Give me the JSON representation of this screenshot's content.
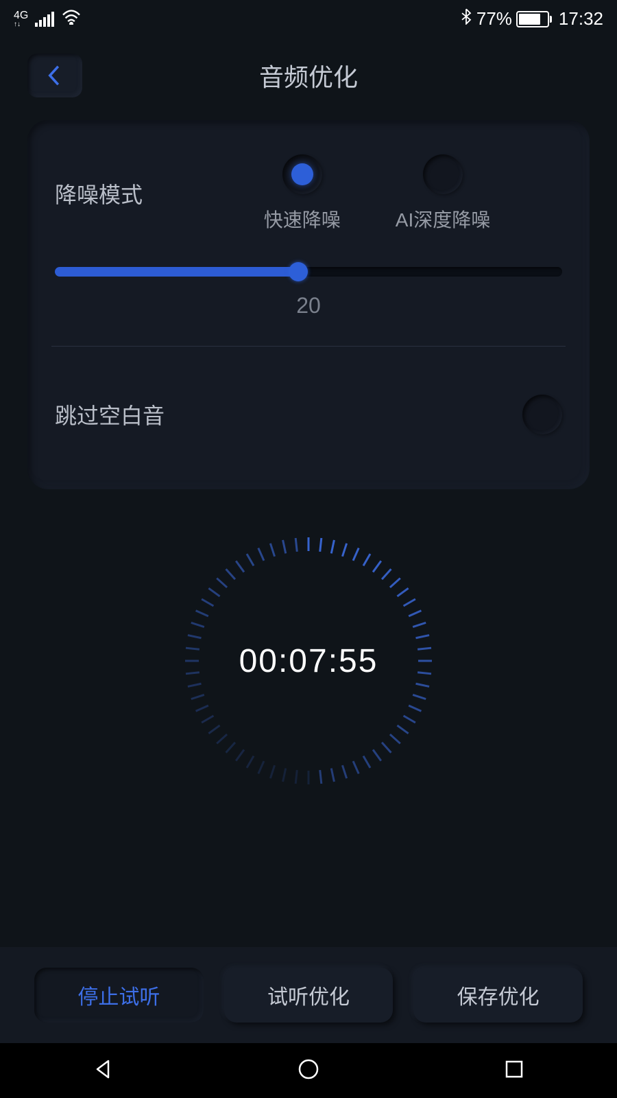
{
  "status": {
    "network": "4G",
    "bluetooth": true,
    "battery_percent": "77%",
    "time": "17:32"
  },
  "header": {
    "title": "音频优化"
  },
  "settings": {
    "noise_reduction": {
      "label": "降噪模式",
      "options": [
        {
          "label": "快速降噪",
          "selected": true
        },
        {
          "label": "AI深度降噪",
          "selected": false
        }
      ],
      "slider_value": "20"
    },
    "skip_silence": {
      "label": "跳过空白音",
      "enabled": false
    }
  },
  "timer": {
    "display": "00:07:55"
  },
  "buttons": {
    "stop": "停止试听",
    "preview": "试听优化",
    "save": "保存优化"
  }
}
